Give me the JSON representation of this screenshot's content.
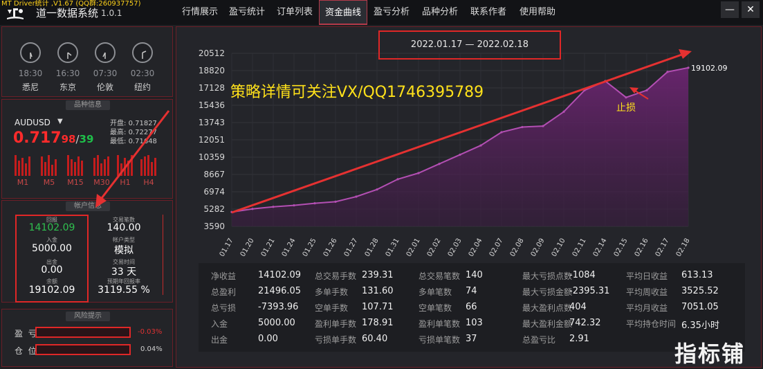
{
  "app": {
    "top_note": "MT Driver统计 ,V1.67 (QQ群:260937757)",
    "name": "道一数据系统",
    "version": "1.0.1"
  },
  "nav": {
    "tabs": [
      {
        "label": "行情展示",
        "active": false
      },
      {
        "label": "盈亏统计",
        "active": false
      },
      {
        "label": "订单列表",
        "active": false
      },
      {
        "label": "资金曲线",
        "active": true
      },
      {
        "label": "盈亏分析",
        "active": false
      },
      {
        "label": "品种分析",
        "active": false
      },
      {
        "label": "联系作者",
        "active": false
      },
      {
        "label": "使用帮助",
        "active": false
      }
    ],
    "minimize_icon": "minimize-icon",
    "close_icon": "close-icon"
  },
  "clocks": [
    {
      "time": "18:30",
      "city": "悉尼",
      "hour": 6,
      "minute": 30
    },
    {
      "time": "16:30",
      "city": "东京",
      "hour": 4,
      "minute": 30
    },
    {
      "time": "07:30",
      "city": "伦敦",
      "hour": 7,
      "minute": 30
    },
    {
      "time": "02:30",
      "city": "纽约",
      "hour": 2,
      "minute": 30
    }
  ],
  "symbol": {
    "title": "品种信息",
    "name": "AUDUSD",
    "price_main": "0.717",
    "price_bid_small": "98",
    "price_sep": "/",
    "price_ask_small": "39",
    "open_label": "开盘:",
    "open_value": "0.71827",
    "high_label": "最高:",
    "high_value": "0.72277",
    "low_label": "最低:",
    "low_value": "0.71648",
    "timeframes": [
      "M1",
      "M5",
      "M15",
      "M30",
      "H1",
      "H4"
    ]
  },
  "account": {
    "title": "帐户信息",
    "return_label": "回报",
    "return_value": "14102.09",
    "deposit_label": "入金",
    "deposit_value": "5000.00",
    "withdraw_label": "出金",
    "withdraw_value": "0.00",
    "balance_label": "余额",
    "balance_value": "19102.09",
    "trades_label": "交易笔数",
    "trades_value": "140.00",
    "type_label": "帐户类型",
    "type_value": "模拟",
    "time_label": "交易时间",
    "time_value": "33 天",
    "annual_label": "预期年回报率",
    "annual_value": "3119.55 %"
  },
  "risk": {
    "title": "风险提示",
    "profit_label": "盈  亏",
    "profit_value": "-0.03%",
    "position_label": "仓  位",
    "position_value": "0.04%"
  },
  "chart_data": {
    "type": "area",
    "title": "2022.01.17 — 2022.02.18",
    "ylim": [
      3590,
      20512
    ],
    "yticks": [
      "20512",
      "18820",
      "17128",
      "15436",
      "13743",
      "12051",
      "10359",
      "8667",
      "6974",
      "5282",
      "3590"
    ],
    "categories": [
      "01.17",
      "01.20",
      "01.21",
      "01.24",
      "01.25",
      "01.26",
      "01.27",
      "01.28",
      "01.31",
      "02.01",
      "02.02",
      "02.03",
      "02.04",
      "02.07",
      "02.08",
      "02.09",
      "02.10",
      "02.11",
      "02.14",
      "02.15",
      "02.16",
      "02.17",
      "02.18"
    ],
    "series": [
      {
        "values": [
          5000,
          5300,
          5500,
          5650,
          5850,
          6000,
          6500,
          7200,
          8200,
          8800,
          9700,
          10600,
          11500,
          12800,
          13300,
          13400,
          14800,
          16900,
          17800,
          16200,
          16900,
          18700,
          19102.09
        ]
      }
    ],
    "end_label": "19102.09",
    "annotation_text": "策略详情可关注VX/QQ1746395789",
    "annotation_stop": "止损",
    "line_color": "#b34fb3",
    "fill_color": "#5a1f60"
  },
  "stats": [
    [
      {
        "label": "净收益",
        "value": "14102.09"
      },
      {
        "label": "总盈利",
        "value": "21496.05"
      },
      {
        "label": "总亏损",
        "value": "-7393.96"
      },
      {
        "label": "入金",
        "value": "5000.00"
      },
      {
        "label": "出金",
        "value": "0.00"
      }
    ],
    [
      {
        "label": "总交易手数",
        "value": "239.31"
      },
      {
        "label": "多单手数",
        "value": "131.60"
      },
      {
        "label": "空单手数",
        "value": "107.71"
      },
      {
        "label": "盈利单手数",
        "value": "178.91"
      },
      {
        "label": "亏损单手数",
        "value": "60.40"
      }
    ],
    [
      {
        "label": "总交易笔数",
        "value": "140"
      },
      {
        "label": "多单笔数",
        "value": "74"
      },
      {
        "label": "空单笔数",
        "value": "66"
      },
      {
        "label": "盈利单笔数",
        "value": "103"
      },
      {
        "label": "亏损单笔数",
        "value": "37"
      }
    ],
    [
      {
        "label": "最大亏损点数",
        "value": "-1084"
      },
      {
        "label": "最大亏损金额",
        "value": "-2395.31"
      },
      {
        "label": "最大盈利点数",
        "value": "404"
      },
      {
        "label": "最大盈利金额",
        "value": "742.32"
      },
      {
        "label": "总盈亏比",
        "value": "2.91"
      }
    ],
    [
      {
        "label": "平均日收益",
        "value": "613.13"
      },
      {
        "label": "平均周收益",
        "value": "3525.52"
      },
      {
        "label": "平均月收益",
        "value": "7051.05"
      },
      {
        "label": "平均持仓时间",
        "value": "6.35小时"
      }
    ]
  ],
  "watermark": "指标铺",
  "colors": {
    "accent_red": "#e02727",
    "price_red": "#ff2b2b",
    "price_green": "#1fbf4a",
    "return_green": "#2fc04f"
  }
}
